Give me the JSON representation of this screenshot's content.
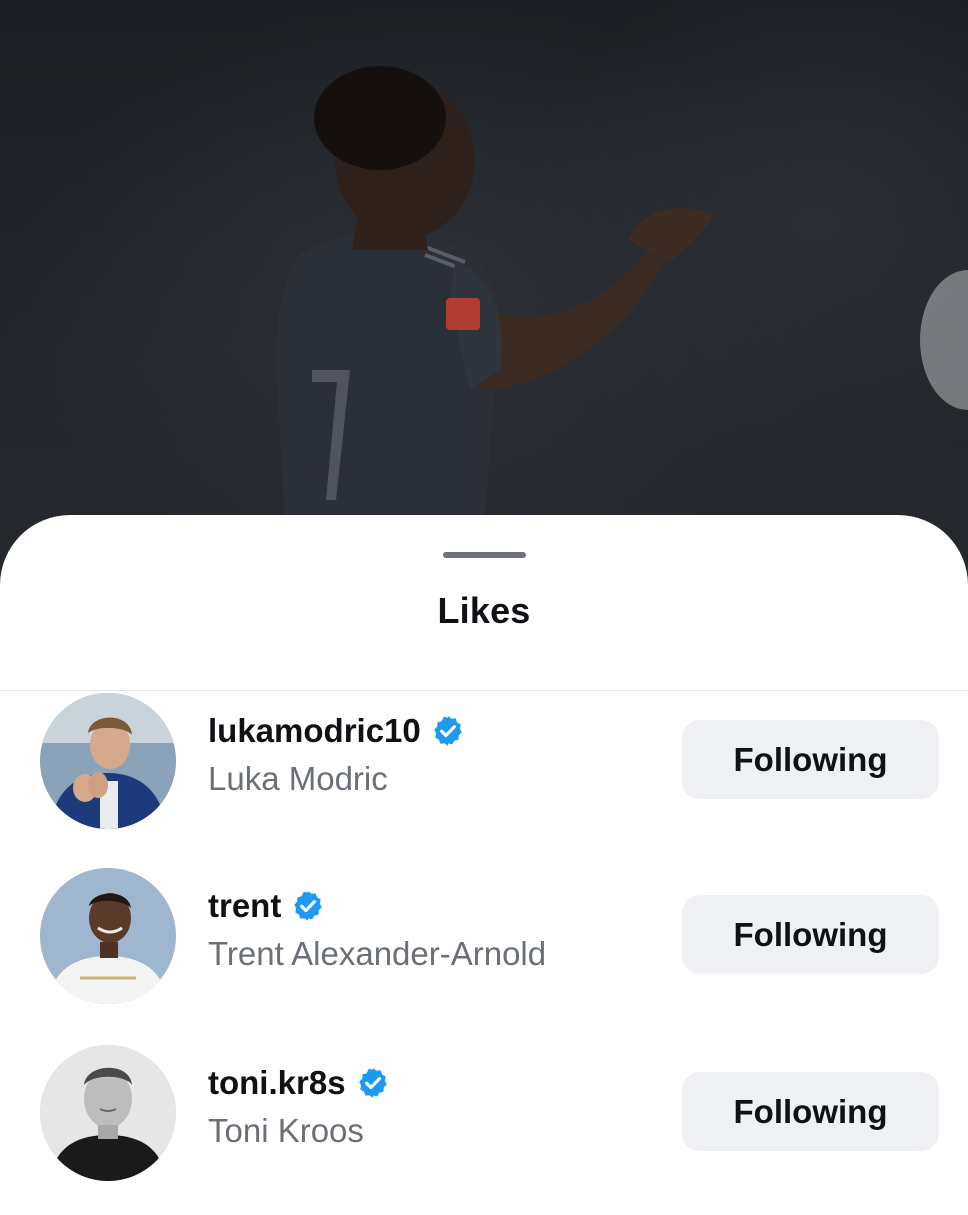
{
  "colors": {
    "verified": "#1d9bf0",
    "sheet": "#ffffff",
    "button_bg": "#eef0f3",
    "secondary_text": "#6b7078"
  },
  "background_photo": {
    "description_icon": "player-photo"
  },
  "sheet": {
    "title": "Likes"
  },
  "likes": [
    {
      "username": "lukamodric10",
      "full_name": "Luka Modric",
      "verified": true,
      "button_label": "Following",
      "avatar_icon": "avatar-photo"
    },
    {
      "username": "trent",
      "full_name": "Trent Alexander-Arnold",
      "verified": true,
      "button_label": "Following",
      "avatar_icon": "avatar-photo"
    },
    {
      "username": "toni.kr8s",
      "full_name": "Toni Kroos",
      "verified": true,
      "button_label": "Following",
      "avatar_icon": "avatar-photo"
    }
  ]
}
